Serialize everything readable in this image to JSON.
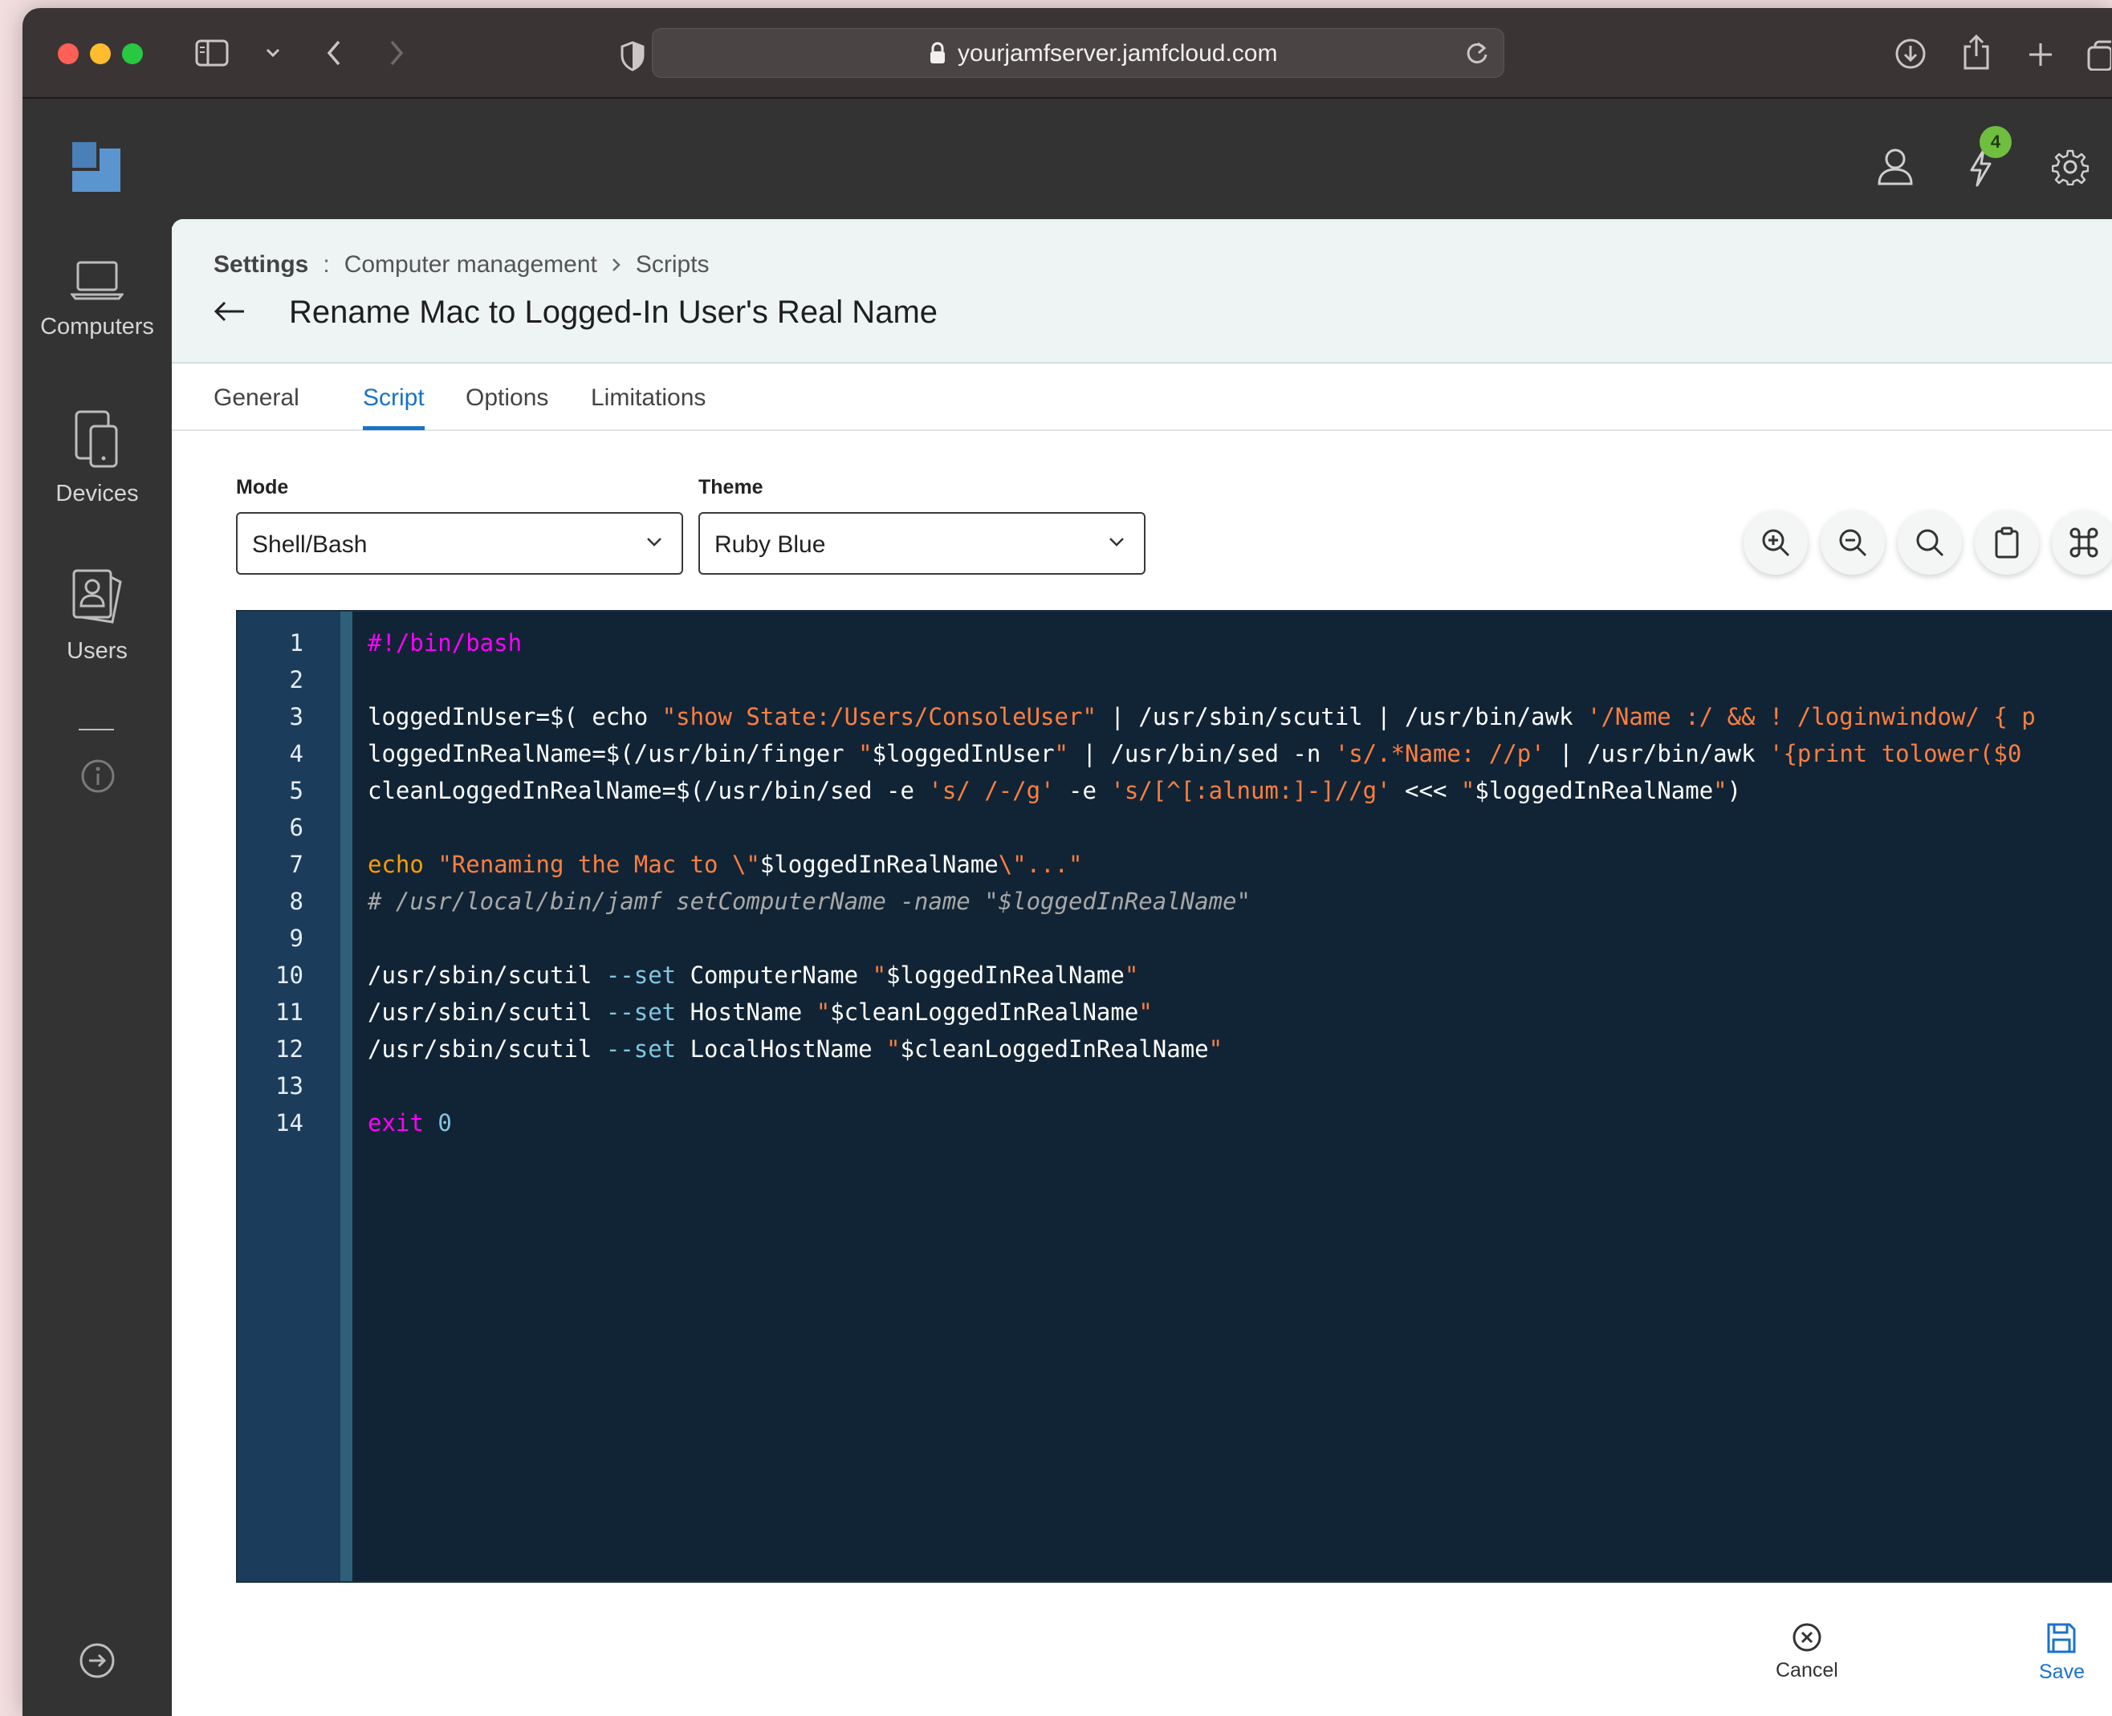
{
  "browser": {
    "url": "yourjamfserver.jamfcloud.com"
  },
  "app": {
    "notifications_count": "4"
  },
  "sidebar": {
    "items": [
      {
        "label": "Computers",
        "icon": "laptop-icon"
      },
      {
        "label": "Devices",
        "icon": "devices-icon"
      },
      {
        "label": "Users",
        "icon": "users-icon"
      }
    ]
  },
  "header": {
    "breadcrumb": {
      "root": "Settings",
      "section": "Computer management",
      "page": "Scripts"
    },
    "title": "Rename Mac to Logged-In User's Real Name"
  },
  "tabs": [
    {
      "label": "General",
      "active": false
    },
    {
      "label": "Script",
      "active": true
    },
    {
      "label": "Options",
      "active": false
    },
    {
      "label": "Limitations",
      "active": false
    }
  ],
  "form": {
    "mode_label": "Mode",
    "mode_value": "Shell/Bash",
    "theme_label": "Theme",
    "theme_value": "Ruby Blue"
  },
  "editor": {
    "line_numbers": [
      "1",
      "2",
      "3",
      "4",
      "5",
      "6",
      "7",
      "8",
      "9",
      "10",
      "11",
      "12",
      "13",
      "14"
    ],
    "lines": [
      "#!/bin/bash",
      "",
      "loggedInUser=$( echo \"show State:/Users/ConsoleUser\" | /usr/sbin/scutil | /usr/bin/awk '/Name :/ && ! /loginwindow/ { p",
      "loggedInRealName=$(/usr/bin/finger \"$loggedInUser\" | /usr/bin/sed -n 's/.*Name: //p' | /usr/bin/awk '{print tolower($0",
      "cleanLoggedInRealName=$(/usr/bin/sed -e 's/ /-/g' -e 's/[^[:alnum:]-]//g' <<< \"$loggedInRealName\")",
      "",
      "echo \"Renaming the Mac to \\\"$loggedInRealName\\\"...\"",
      "# /usr/local/bin/jamf setComputerName -name \"$loggedInRealName\"",
      "",
      "/usr/sbin/scutil --set ComputerName \"$loggedInRealName\"",
      "/usr/sbin/scutil --set HostName \"$cleanLoggedInRealName\"",
      "/usr/sbin/scutil --set LocalHostName \"$cleanLoggedInRealName\"",
      "",
      "exit 0"
    ],
    "theme_colors": {
      "background": "#112435",
      "gutter": "#1c3c5c",
      "keyword": "#ff00ff",
      "string": "#ff7f3f",
      "flag": "#82c6e0"
    }
  },
  "actions": {
    "cancel_label": "Cancel",
    "save_label": "Save"
  },
  "colors": {
    "accent": "#1a73c9",
    "sidebar_bg": "#333333",
    "badge": "#6fbe3f"
  }
}
